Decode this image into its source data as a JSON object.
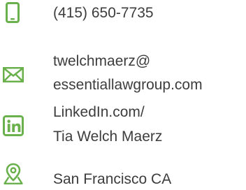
{
  "theme": {
    "icon_color": "#6ab04c",
    "text_color": "#3d3d3d"
  },
  "contacts": {
    "phone": {
      "icon": "phone-icon",
      "lines": [
        "(415) 650-7735"
      ]
    },
    "email": {
      "icon": "email-icon",
      "lines": [
        "twelchmaerz@",
        "essentiallawgroup.com"
      ]
    },
    "linkedin": {
      "icon": "linkedin-icon",
      "lines": [
        "LinkedIn.com/",
        "Tia Welch Maerz"
      ]
    },
    "location": {
      "icon": "location-pin-icon",
      "lines": [
        "San Francisco CA"
      ]
    }
  }
}
